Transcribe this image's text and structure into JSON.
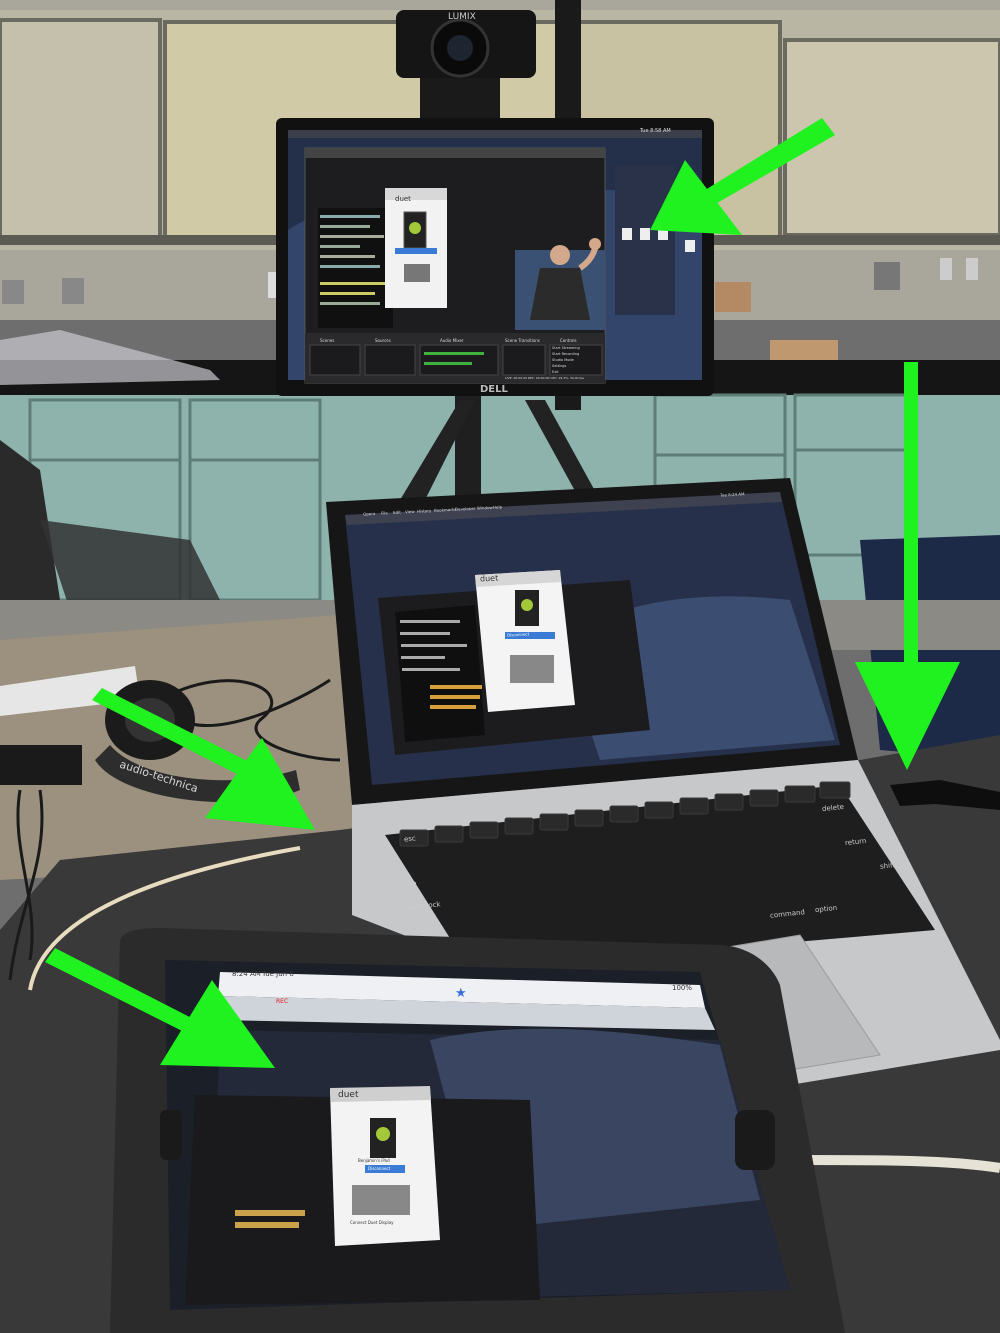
{
  "photo": {
    "colors": {
      "arrow": "#1ff21f",
      "wall": "#a8a69a",
      "cabinet": "#8fb3ad",
      "counter": "#111111",
      "desk": "#3a3a3a",
      "table_top": "#9a8f7e",
      "screen_wallpaper": "#2b3550",
      "laptop_body": "#c9cacc"
    }
  },
  "camera": {
    "brand": "LUMIX"
  },
  "monitor": {
    "brand": "DELL",
    "screen": {
      "menu_bar_clock": "Tue 8:58 AM",
      "obs_panels": [
        "Scenes",
        "Sources",
        "Audio Mixer",
        "Scene Transitions",
        "Controls"
      ],
      "obs_controls": [
        "Start Streaming",
        "Start Recording",
        "Studio Mode",
        "Settings",
        "Exit"
      ],
      "status_bar": "LIVE: 00:00:00   REC: 00:00:00   CPU: 18.3%, 30.00 fps"
    }
  },
  "laptop": {
    "menu_bar_items": [
      "Opera",
      "File",
      "Edit",
      "View",
      "History",
      "Bookmarks",
      "Developer",
      "Window",
      "Help"
    ],
    "menu_bar_clock": "Tue 8:24 AM",
    "keyboard_labels": {
      "esc": "esc",
      "tab": "tab",
      "caps": "caps lock",
      "shift": "shift",
      "delete": "delete",
      "return": "return",
      "command": "command",
      "option": "option"
    }
  },
  "duet_window": {
    "title": "duet",
    "device_name": "Benjamin's iPad",
    "disconnect_label": "Disconnect",
    "connect_label": "Connect Duet Display"
  },
  "headphones": {
    "brand": "audio-technica"
  },
  "ipad": {
    "status_time": "8:24 AM",
    "status_date": "Tue Jun 8",
    "battery": "100%",
    "toolbar_rec": "REC"
  },
  "arrows": [
    {
      "name": "arrow-to-monitor"
    },
    {
      "name": "arrow-hdmi-down"
    },
    {
      "name": "arrow-to-laptop-cable"
    },
    {
      "name": "arrow-to-ipad"
    }
  ]
}
